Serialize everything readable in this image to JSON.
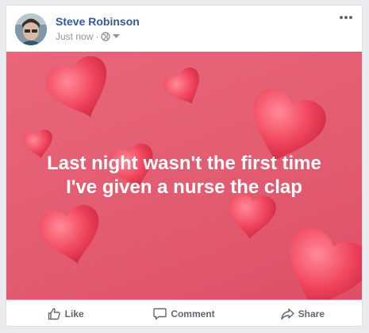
{
  "post": {
    "author": "Steve Robinson",
    "timestamp": "Just now",
    "separator": "·",
    "privacy_icon": "globe-icon",
    "menu_icon": "more-options-icon",
    "text_line_1": "Last night wasn't the first time",
    "text_line_2": "I've given a nurse the clap",
    "background_color": "#e35d72"
  },
  "actions": {
    "like_label": "Like",
    "comment_label": "Comment",
    "share_label": "Share"
  },
  "colors": {
    "author_link": "#365899",
    "secondary_text": "#90949c",
    "action_text": "#606770"
  }
}
